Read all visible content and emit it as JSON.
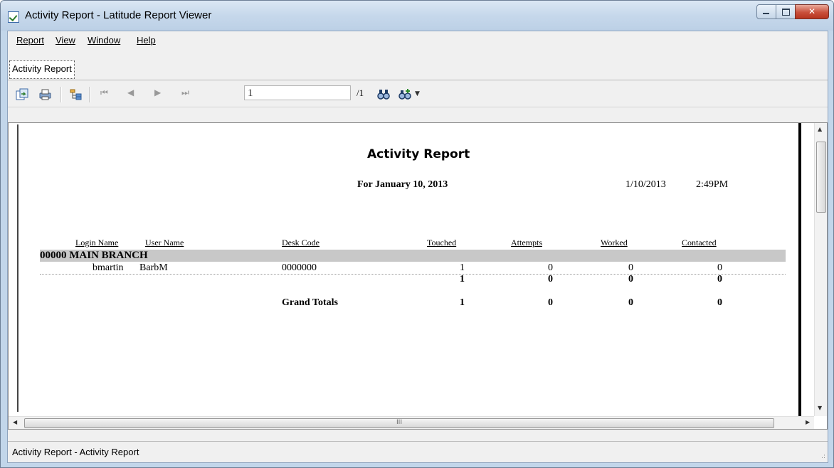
{
  "window": {
    "title": "Activity Report - Latitude Report Viewer"
  },
  "menu": [
    "Report",
    "View",
    "Window",
    "Help"
  ],
  "tab": {
    "label": "Activity Report"
  },
  "toolbar": {
    "page_value": "1",
    "page_total": "/1"
  },
  "report": {
    "title": "Activity Report",
    "subtitle": "For January 10, 2013",
    "date": "1/10/2013",
    "time": "2:49PM",
    "columns": [
      "Login Name",
      "User Name",
      "Desk Code",
      "Touched",
      "Attempts",
      "Worked",
      "Contacted"
    ],
    "group": "00000 MAIN BRANCH",
    "row": {
      "login": "bmartin",
      "user": "BarbM",
      "desk": "0000000",
      "touched": "1",
      "attempts": "0",
      "worked": "0",
      "contacted": "0"
    },
    "subtotal": {
      "touched": "1",
      "attempts": "0",
      "worked": "0",
      "contacted": "0"
    },
    "grand": {
      "label": "Grand Totals",
      "touched": "1",
      "attempts": "0",
      "worked": "0",
      "contacted": "0"
    }
  },
  "scrollbar": {
    "hthumb_grip": "III"
  },
  "status": {
    "text": "Activity Report - Activity Report",
    "grip": ".:"
  }
}
